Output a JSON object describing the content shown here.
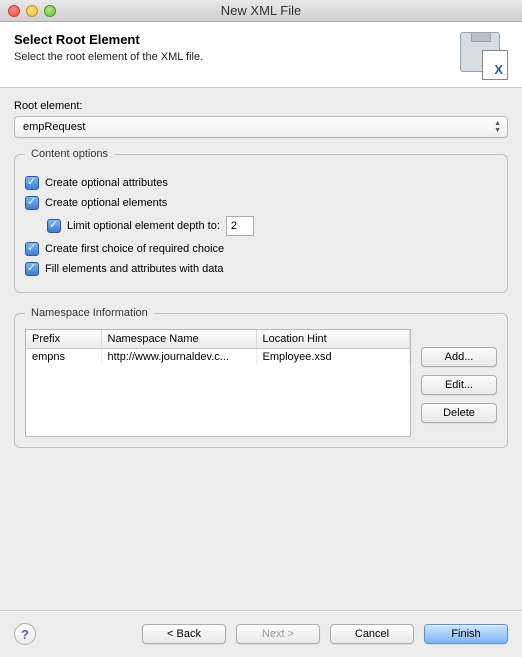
{
  "window": {
    "title": "New XML File"
  },
  "header": {
    "title": "Select Root Element",
    "subtitle": "Select the root element of the XML file."
  },
  "rootElement": {
    "label": "Root element:",
    "value": "empRequest"
  },
  "contentOptions": {
    "legend": "Content options",
    "opt1": {
      "label": "Create optional attributes",
      "checked": true
    },
    "opt2": {
      "label": "Create optional elements",
      "checked": true
    },
    "opt3": {
      "label": "Limit optional element depth to:",
      "checked": true,
      "value": "2"
    },
    "opt4": {
      "label": "Create first choice of required choice",
      "checked": true
    },
    "opt5": {
      "label": "Fill elements and attributes with data",
      "checked": true
    }
  },
  "namespace": {
    "legend": "Namespace Information",
    "columns": {
      "prefix": "Prefix",
      "name": "Namespace Name",
      "hint": "Location Hint"
    },
    "rows": [
      {
        "prefix": "empns",
        "name": "http://www.journaldev.c...",
        "hint": "Employee.xsd"
      }
    ],
    "buttons": {
      "add": "Add...",
      "edit": "Edit...",
      "delete": "Delete"
    }
  },
  "footer": {
    "back": "< Back",
    "next": "Next >",
    "cancel": "Cancel",
    "finish": "Finish"
  }
}
